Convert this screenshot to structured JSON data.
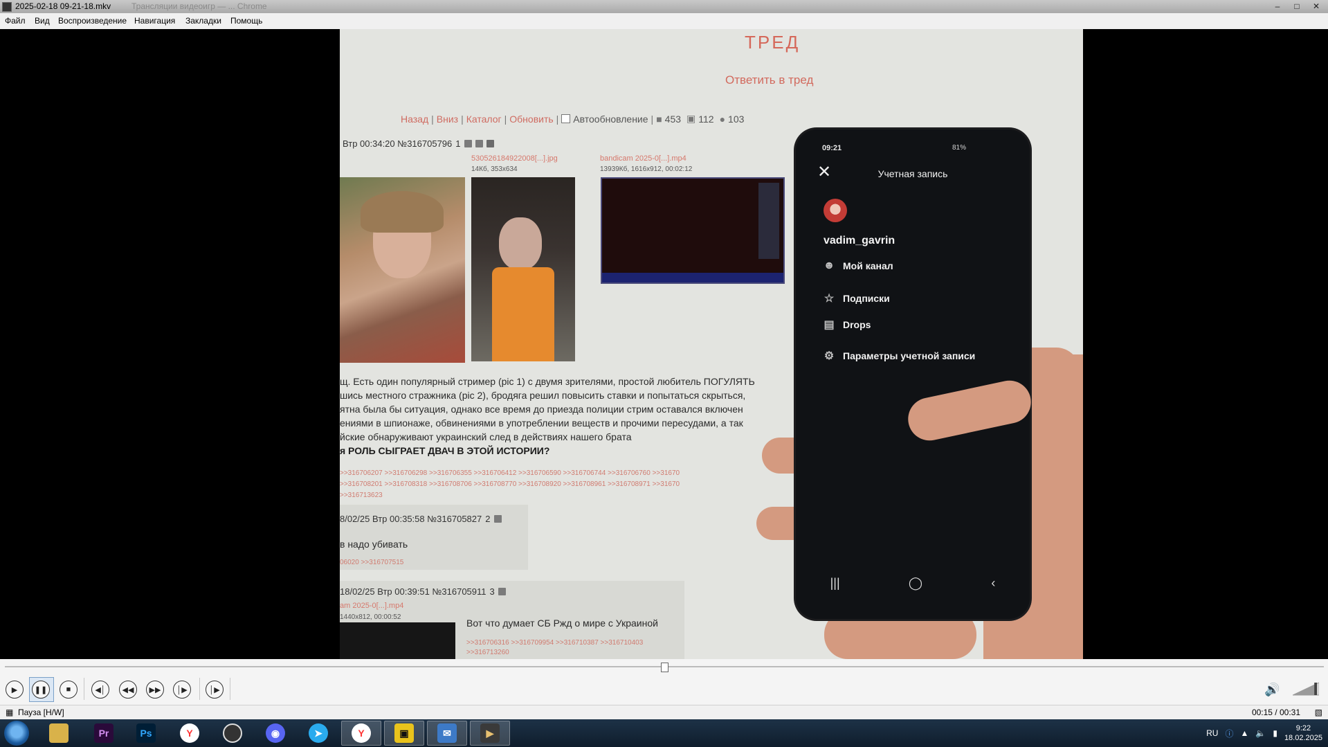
{
  "window": {
    "title": "2025-02-18 09-21-18.mkv",
    "title_ghost": "Трансляции видеоигр — ... Chrome",
    "minimize": "–",
    "maximize": "□",
    "close": "✕"
  },
  "menu": [
    "Файл",
    "Вид",
    "Воспроизведение",
    "Навигация",
    "Закладки",
    "Помощь"
  ],
  "frame": {
    "board_title": "ТРЕД",
    "reply_link": "Ответить в тред",
    "nav": {
      "back": "Назад",
      "down": "Вниз",
      "catalog": "Каталог",
      "refresh": "Обновить",
      "auto_refresh": "Автообновление",
      "posts_count": "453",
      "files_count": "112",
      "posters_count": "103"
    },
    "op": {
      "header": "Втр 00:34:20 №316705796",
      "num": "1",
      "file1_name": "530526184922008[...].jpg",
      "file1_meta": "14Кб, 353x634",
      "file2_name": "bandicam 2025-0[...].mp4",
      "file2_meta": "13939Кб, 1616x912, 00:02:12",
      "lines": [
        "щ. Есть один популярный стример (pic 1) с двумя зрителями, простой любитель ПОГУЛЯТЬ",
        "шись местного стражника (pic 2), бродяга решил повысить ставки и попытаться скрыться,",
        "ятна была бы ситуация, однако все время до приезда полиции стрим оставался включен",
        "ениями в шпионаже, обвинениями в употреблении веществ и прочими пересудами, а так",
        "йские обнаруживают украинский след в действиях нашего брата"
      ],
      "caps": "я РОЛЬ СЫГРАЕТ ДВАЧ В ЭТОЙ ИСТОРИИ?",
      "replies": [
        ">>316706207 >>316706298 >>316706355 >>316706412 >>316706590 >>316706744 >>316706760 >>31670",
        ">>316708201 >>316708318 >>316708706 >>316708770 >>316708920 >>316708961 >>316708971 >>31670",
        ">>316713623"
      ]
    },
    "post2": {
      "header": "8/02/25 Втр 00:35:58 №316705827",
      "num": "2",
      "text": "в надо убивать",
      "replies": "06020 >>316707515"
    },
    "post3": {
      "header": "18/02/25 Втр 00:39:51 №316705911",
      "num": "3",
      "file_name": "am 2025-0[...].mp4",
      "file_meta": "1440x812, 00:00:52",
      "text": "Вот что думает СБ Ржд о мире с Украиной",
      "replies1": ">>316706316 >>316709954 >>316710387 >>316710403",
      "replies2": ">>316713260"
    }
  },
  "phone": {
    "time": "09:21",
    "battery": "81%",
    "header": "Учетная запись",
    "username": "vadim_gavrin",
    "items": [
      {
        "label": "Мой канал",
        "icon": "person-icon"
      },
      {
        "label": "Подписки",
        "icon": "star-icon"
      },
      {
        "label": "Drops",
        "icon": "box-icon"
      },
      {
        "label": "Параметры учетной записи",
        "icon": "gear-icon"
      }
    ]
  },
  "player": {
    "progress": 0.5,
    "status": "Пауза [H/W]",
    "time": "00:15 / 00:31",
    "volume": 0.9
  },
  "tray": {
    "lang": "RU",
    "time": "9:22",
    "date": "18.02.2025"
  },
  "taskbar_apps": [
    "explorer",
    "Pr",
    "Ps",
    "yandex",
    "obs",
    "discord",
    "telegram",
    "yandex-browser",
    "security",
    "mail",
    "media-player"
  ]
}
